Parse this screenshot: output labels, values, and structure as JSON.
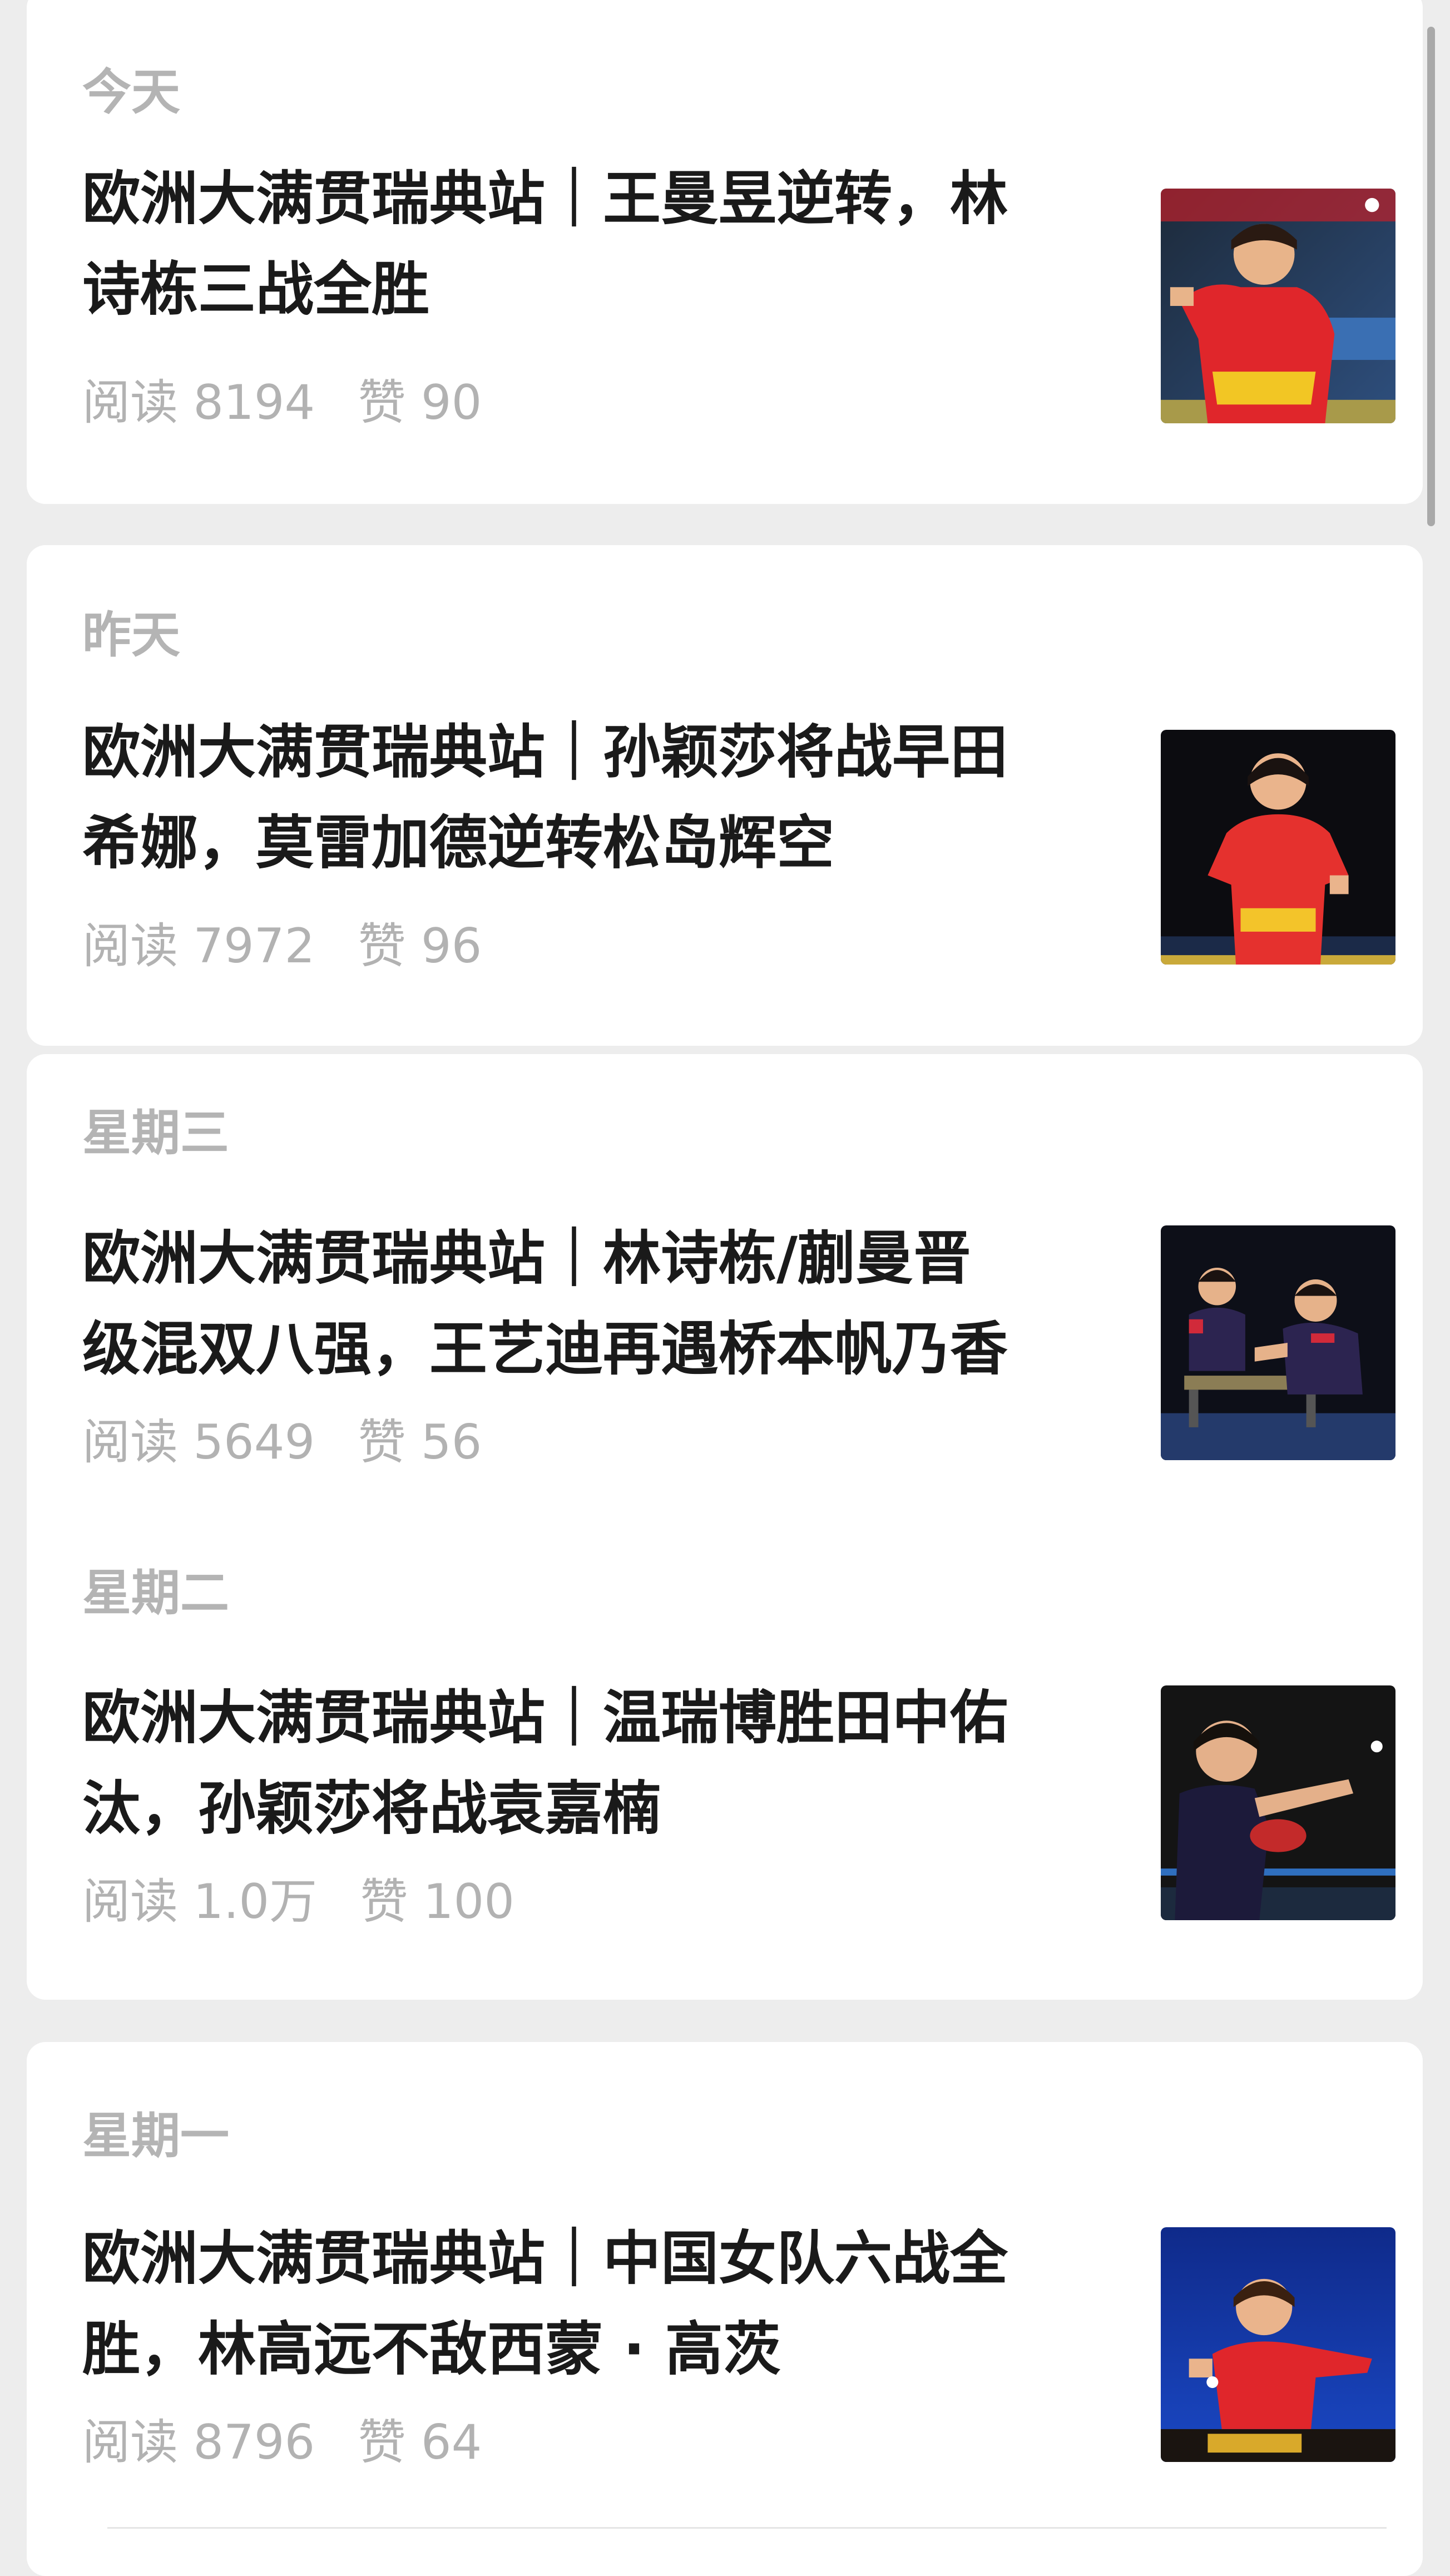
{
  "articles": [
    {
      "day": "今天",
      "title_line1": "欧洲大满贯瑞典站｜王曼昱逆转，林",
      "title_line2": "诗栋三战全胜",
      "reads_label": "阅读",
      "reads": "8194",
      "likes_label": "赞",
      "likes": "90",
      "thumb_icon": "table-tennis-player-photo"
    },
    {
      "day": "昨天",
      "title_line1": "欧洲大满贯瑞典站｜孙颖莎将战早田",
      "title_line2": "希娜，莫雷加德逆转松岛辉空",
      "reads_label": "阅读",
      "reads": "7972",
      "likes_label": "赞",
      "likes": "96",
      "thumb_icon": "table-tennis-player-photo"
    },
    {
      "day": "星期三",
      "title_line1": "欧洲大满贯瑞典站｜林诗栋/蒯曼晋",
      "title_line2": "级混双八强，王艺迪再遇桥本帆乃香",
      "reads_label": "阅读",
      "reads": "5649",
      "likes_label": "赞",
      "likes": "56",
      "thumb_icon": "mixed-doubles-photo"
    },
    {
      "day": "星期二",
      "title_line1": "欧洲大满贯瑞典站｜温瑞博胜田中佑",
      "title_line2": "汰，孙颖莎将战袁嘉楠",
      "reads_label": "阅读",
      "reads": "1.0万",
      "likes_label": "赞",
      "likes": "100",
      "thumb_icon": "table-tennis-player-photo"
    },
    {
      "day": "星期一",
      "title_line1": "欧洲大满贯瑞典站｜中国女队六战全",
      "title_line2": "胜，林高远不敌西蒙 · 高茨",
      "reads_label": "阅读",
      "reads": "8796",
      "likes_label": "赞",
      "likes": "64",
      "thumb_icon": "table-tennis-player-photo"
    }
  ]
}
